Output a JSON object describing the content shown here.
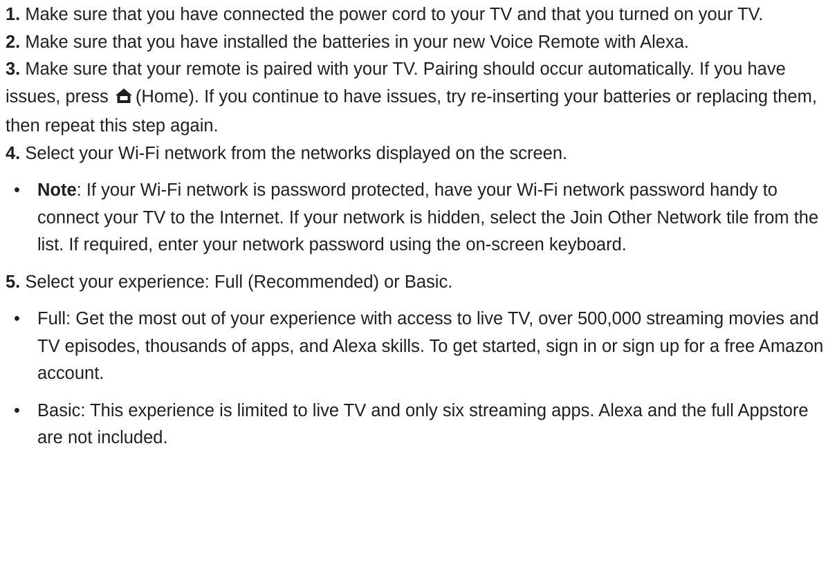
{
  "steps": [
    {
      "number": "1.",
      "text": "Make sure that you have connected the power cord to your TV and that you turned on your TV."
    },
    {
      "number": "2.",
      "text": "Make sure that you have installed the batteries in your new Voice Remote with Alexa."
    },
    {
      "number": "3.",
      "text_before_icon": "Make sure that your remote is paired with your TV. Pairing should occur automatically. If you have issues, press",
      "icon": "home-icon",
      "text_after_icon": "(Home). If you continue to have issues, try re-inserting your batteries or replacing them, then repeat this step again."
    },
    {
      "number": "4.",
      "text": "Select your Wi-Fi network from the networks displayed on the screen.",
      "sub": [
        {
          "label": "Note",
          "text": ": If your Wi-Fi network is password protected, have your Wi-Fi network password handy to connect your TV to the Internet. If your network is hidden, select the Join Other Network tile from the list. If required, enter your network password using the on-screen keyboard."
        }
      ]
    },
    {
      "number": "5.",
      "text": "Select your experience: Full (Recommended) or Basic.",
      "sub": [
        {
          "text": "Full: Get the most out of your experience with access to live TV, over 500,000 streaming movies and TV episodes, thousands of apps, and Alexa skills. To get started, sign in or sign up for a free Amazon account."
        },
        {
          "text": "Basic: This experience is limited to live TV and only six streaming apps. Alexa and the full Appstore are not included."
        }
      ]
    }
  ],
  "bullet_glyph": "•"
}
